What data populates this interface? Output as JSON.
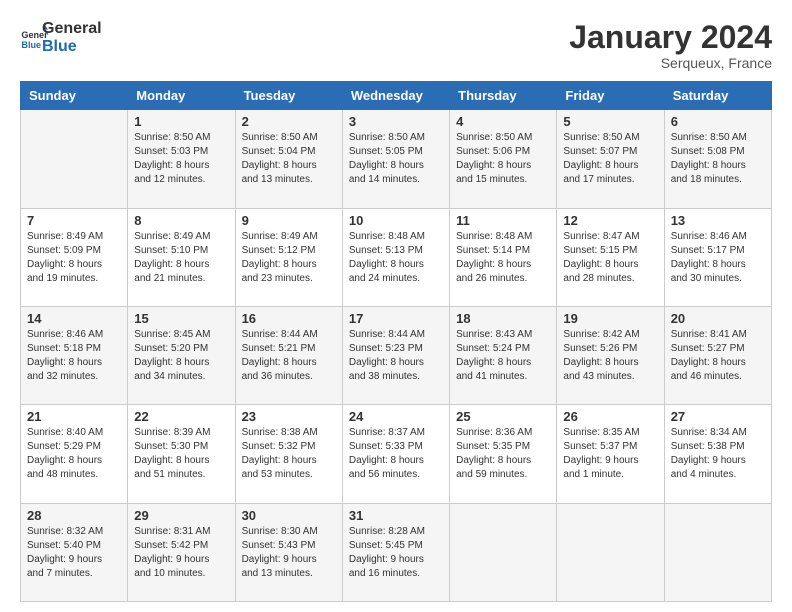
{
  "header": {
    "logo_line1": "General",
    "logo_line2": "Blue",
    "month": "January 2024",
    "location": "Serqueux, France"
  },
  "days_of_week": [
    "Sunday",
    "Monday",
    "Tuesday",
    "Wednesday",
    "Thursday",
    "Friday",
    "Saturday"
  ],
  "weeks": [
    [
      {
        "day": "",
        "sunrise": "",
        "sunset": "",
        "daylight": ""
      },
      {
        "day": "1",
        "sunrise": "Sunrise: 8:50 AM",
        "sunset": "Sunset: 5:03 PM",
        "daylight": "Daylight: 8 hours and 12 minutes."
      },
      {
        "day": "2",
        "sunrise": "Sunrise: 8:50 AM",
        "sunset": "Sunset: 5:04 PM",
        "daylight": "Daylight: 8 hours and 13 minutes."
      },
      {
        "day": "3",
        "sunrise": "Sunrise: 8:50 AM",
        "sunset": "Sunset: 5:05 PM",
        "daylight": "Daylight: 8 hours and 14 minutes."
      },
      {
        "day": "4",
        "sunrise": "Sunrise: 8:50 AM",
        "sunset": "Sunset: 5:06 PM",
        "daylight": "Daylight: 8 hours and 15 minutes."
      },
      {
        "day": "5",
        "sunrise": "Sunrise: 8:50 AM",
        "sunset": "Sunset: 5:07 PM",
        "daylight": "Daylight: 8 hours and 17 minutes."
      },
      {
        "day": "6",
        "sunrise": "Sunrise: 8:50 AM",
        "sunset": "Sunset: 5:08 PM",
        "daylight": "Daylight: 8 hours and 18 minutes."
      }
    ],
    [
      {
        "day": "7",
        "sunrise": "Sunrise: 8:49 AM",
        "sunset": "Sunset: 5:09 PM",
        "daylight": "Daylight: 8 hours and 19 minutes."
      },
      {
        "day": "8",
        "sunrise": "Sunrise: 8:49 AM",
        "sunset": "Sunset: 5:10 PM",
        "daylight": "Daylight: 8 hours and 21 minutes."
      },
      {
        "day": "9",
        "sunrise": "Sunrise: 8:49 AM",
        "sunset": "Sunset: 5:12 PM",
        "daylight": "Daylight: 8 hours and 23 minutes."
      },
      {
        "day": "10",
        "sunrise": "Sunrise: 8:48 AM",
        "sunset": "Sunset: 5:13 PM",
        "daylight": "Daylight: 8 hours and 24 minutes."
      },
      {
        "day": "11",
        "sunrise": "Sunrise: 8:48 AM",
        "sunset": "Sunset: 5:14 PM",
        "daylight": "Daylight: 8 hours and 26 minutes."
      },
      {
        "day": "12",
        "sunrise": "Sunrise: 8:47 AM",
        "sunset": "Sunset: 5:15 PM",
        "daylight": "Daylight: 8 hours and 28 minutes."
      },
      {
        "day": "13",
        "sunrise": "Sunrise: 8:46 AM",
        "sunset": "Sunset: 5:17 PM",
        "daylight": "Daylight: 8 hours and 30 minutes."
      }
    ],
    [
      {
        "day": "14",
        "sunrise": "Sunrise: 8:46 AM",
        "sunset": "Sunset: 5:18 PM",
        "daylight": "Daylight: 8 hours and 32 minutes."
      },
      {
        "day": "15",
        "sunrise": "Sunrise: 8:45 AM",
        "sunset": "Sunset: 5:20 PM",
        "daylight": "Daylight: 8 hours and 34 minutes."
      },
      {
        "day": "16",
        "sunrise": "Sunrise: 8:44 AM",
        "sunset": "Sunset: 5:21 PM",
        "daylight": "Daylight: 8 hours and 36 minutes."
      },
      {
        "day": "17",
        "sunrise": "Sunrise: 8:44 AM",
        "sunset": "Sunset: 5:23 PM",
        "daylight": "Daylight: 8 hours and 38 minutes."
      },
      {
        "day": "18",
        "sunrise": "Sunrise: 8:43 AM",
        "sunset": "Sunset: 5:24 PM",
        "daylight": "Daylight: 8 hours and 41 minutes."
      },
      {
        "day": "19",
        "sunrise": "Sunrise: 8:42 AM",
        "sunset": "Sunset: 5:26 PM",
        "daylight": "Daylight: 8 hours and 43 minutes."
      },
      {
        "day": "20",
        "sunrise": "Sunrise: 8:41 AM",
        "sunset": "Sunset: 5:27 PM",
        "daylight": "Daylight: 8 hours and 46 minutes."
      }
    ],
    [
      {
        "day": "21",
        "sunrise": "Sunrise: 8:40 AM",
        "sunset": "Sunset: 5:29 PM",
        "daylight": "Daylight: 8 hours and 48 minutes."
      },
      {
        "day": "22",
        "sunrise": "Sunrise: 8:39 AM",
        "sunset": "Sunset: 5:30 PM",
        "daylight": "Daylight: 8 hours and 51 minutes."
      },
      {
        "day": "23",
        "sunrise": "Sunrise: 8:38 AM",
        "sunset": "Sunset: 5:32 PM",
        "daylight": "Daylight: 8 hours and 53 minutes."
      },
      {
        "day": "24",
        "sunrise": "Sunrise: 8:37 AM",
        "sunset": "Sunset: 5:33 PM",
        "daylight": "Daylight: 8 hours and 56 minutes."
      },
      {
        "day": "25",
        "sunrise": "Sunrise: 8:36 AM",
        "sunset": "Sunset: 5:35 PM",
        "daylight": "Daylight: 8 hours and 59 minutes."
      },
      {
        "day": "26",
        "sunrise": "Sunrise: 8:35 AM",
        "sunset": "Sunset: 5:37 PM",
        "daylight": "Daylight: 9 hours and 1 minute."
      },
      {
        "day": "27",
        "sunrise": "Sunrise: 8:34 AM",
        "sunset": "Sunset: 5:38 PM",
        "daylight": "Daylight: 9 hours and 4 minutes."
      }
    ],
    [
      {
        "day": "28",
        "sunrise": "Sunrise: 8:32 AM",
        "sunset": "Sunset: 5:40 PM",
        "daylight": "Daylight: 9 hours and 7 minutes."
      },
      {
        "day": "29",
        "sunrise": "Sunrise: 8:31 AM",
        "sunset": "Sunset: 5:42 PM",
        "daylight": "Daylight: 9 hours and 10 minutes."
      },
      {
        "day": "30",
        "sunrise": "Sunrise: 8:30 AM",
        "sunset": "Sunset: 5:43 PM",
        "daylight": "Daylight: 9 hours and 13 minutes."
      },
      {
        "day": "31",
        "sunrise": "Sunrise: 8:28 AM",
        "sunset": "Sunset: 5:45 PM",
        "daylight": "Daylight: 9 hours and 16 minutes."
      },
      {
        "day": "",
        "sunrise": "",
        "sunset": "",
        "daylight": ""
      },
      {
        "day": "",
        "sunrise": "",
        "sunset": "",
        "daylight": ""
      },
      {
        "day": "",
        "sunrise": "",
        "sunset": "",
        "daylight": ""
      }
    ]
  ]
}
